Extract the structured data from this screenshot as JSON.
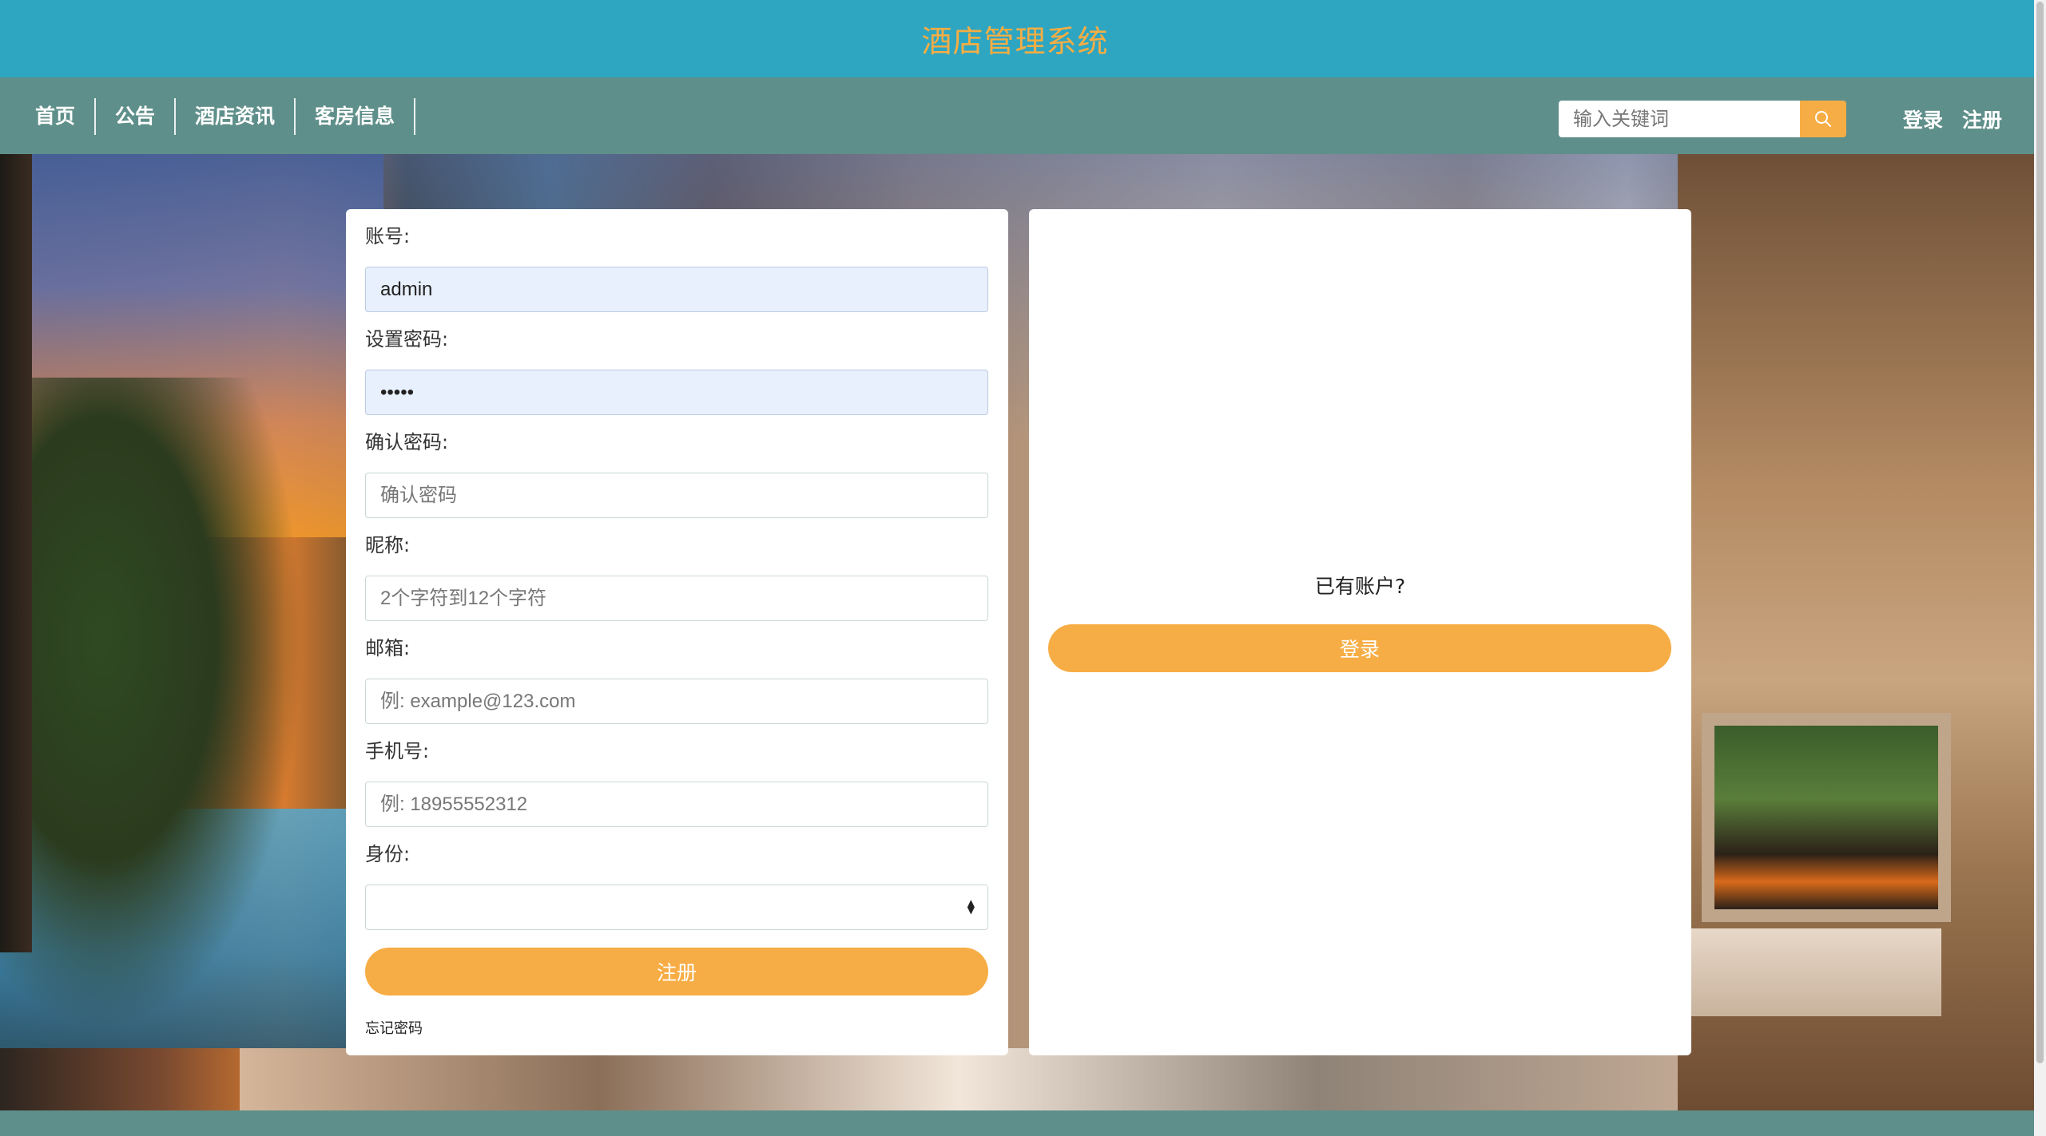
{
  "header": {
    "title": "酒店管理系统"
  },
  "nav": {
    "items": [
      "首页",
      "公告",
      "酒店资讯",
      "客房信息"
    ],
    "search_placeholder": "输入关键词",
    "login_label": "登录",
    "register_label": "注册"
  },
  "register_form": {
    "account_label": "账号:",
    "account_value": "admin",
    "password_label": "设置密码:",
    "password_value": "•••••",
    "confirm_label": "确认密码:",
    "confirm_placeholder": "确认密码",
    "nickname_label": "昵称:",
    "nickname_placeholder": "2个字符到12个字符",
    "email_label": "邮箱:",
    "email_placeholder": "例: example@123.com",
    "phone_label": "手机号:",
    "phone_placeholder": "例: 18955552312",
    "role_label": "身份:",
    "role_value": "",
    "submit_label": "注册",
    "forgot_label": "忘记密码"
  },
  "login_panel": {
    "prompt": "已有账户?",
    "login_button": "登录"
  },
  "colors": {
    "header_bg": "#2ea6c2",
    "nav_bg": "#5f8f8a",
    "accent": "#f7ad45",
    "title_color": "#f6ad43"
  }
}
